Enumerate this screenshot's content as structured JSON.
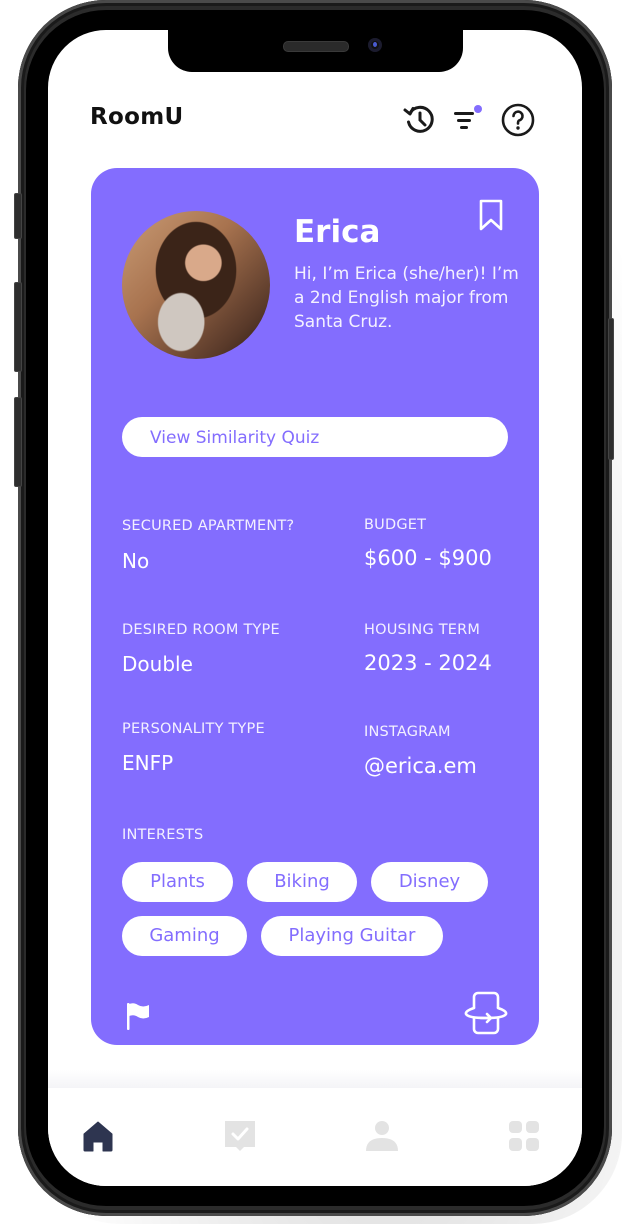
{
  "app": {
    "logo": "RoomU",
    "header_icons": [
      "history-icon",
      "filter-icon",
      "help-icon"
    ],
    "filter_badge_color": "#836DFE"
  },
  "profile": {
    "name": "Erica",
    "bio": "Hi, I’m Erica (she/her)! I’m a 2nd English major from Santa Cruz.",
    "quiz_button": "View Similarity Quiz",
    "fields": {
      "secured_apartment": {
        "label": "SECURED APARTMENT?",
        "value": "No"
      },
      "budget": {
        "label": "BUDGET",
        "value": "$600 - $900"
      },
      "room_type": {
        "label": "DESIRED ROOM TYPE",
        "value": "Double"
      },
      "housing_term": {
        "label": "HOUSING TERM",
        "value": "2023 - 2024"
      },
      "personality": {
        "label": "PERSONALITY TYPE",
        "value": "ENFP"
      },
      "instagram": {
        "label": "INSTAGRAM",
        "value": "@erica.em"
      }
    },
    "interests_label": "INTERESTS",
    "interests": [
      "Plants",
      "Biking",
      "Disney",
      "Gaming",
      "Playing Guitar"
    ],
    "card_color": "#836DFE"
  },
  "tabbar": {
    "items": [
      {
        "name": "home",
        "active": true
      },
      {
        "name": "matches",
        "active": false
      },
      {
        "name": "profile",
        "active": false
      },
      {
        "name": "more",
        "active": false
      }
    ],
    "active_color": "#2E3550",
    "inactive_color": "#E3E3E3"
  }
}
